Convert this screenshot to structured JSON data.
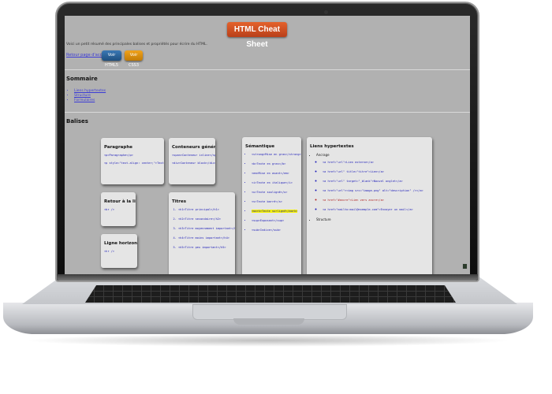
{
  "page": {
    "title": "HTML Cheat Sheet",
    "intro": "Voici un petit résumé des principales balises et propriétés pour écrire du HTML.",
    "top_link": "Retour page d'accueil",
    "button_blue": "Voir HTML5",
    "button_orange": "Voir CSS3"
  },
  "summary": {
    "heading": "Sommaire",
    "items": [
      "Liens hypertextes",
      "Structure",
      "Formulaires"
    ]
  },
  "tags": {
    "heading": "Balises",
    "paragraphe": {
      "title": "Paragraphe",
      "line1": "<p>Paragraphe</p>",
      "line2": "<p style=\"text-align: center;\">Texte</p>"
    },
    "conteneurs": {
      "title": "Conteneurs génériques",
      "line1": "<span>Conteneur inline</span>",
      "line2": "<div>Conteneur block</div>"
    },
    "retour": {
      "title": "Retour à la ligne",
      "code": "<br />"
    },
    "ligne": {
      "title": "Ligne horizontale",
      "code": "<hr />"
    },
    "titres": {
      "title": "Titres",
      "items": [
        "<h1>Titre principal</h1>",
        "<h2>Titre secondaire</h2>",
        "<h3>Titre moyennement important</h3>",
        "<h4>Titre moins important</h4>",
        "<h5>Titre peu important</h5>"
      ]
    },
    "semantique": {
      "title": "Sémantique",
      "items": [
        "<strong>Mise en gras</strong>",
        "<b>Texte en gras</b>",
        "<em>Mise en avant</em>",
        "<i>Texte en italique</i>",
        "<u>Texte souligné</u>",
        "<s>Texte barré</s>",
        "<mark>Texte surligné</mark>",
        "<sup>Exposant</sup>",
        "<sub>Indice</sub>"
      ]
    },
    "liens": {
      "title": "Liens hypertextes",
      "group_label": "Ancrage",
      "items": [
        "<a href=\"url\">Lien externe</a>",
        "<a href=\"url\" title=\"titre\">Lien</a>",
        "<a href=\"url\" target=\"_blank\">Nouvel onglet</a>",
        "<a href=\"url\"><img src=\"image.png\" alt=\"description\" /></a>",
        "<a href=\"#ancre\">Lien vers ancre</a>",
        "<a href=\"mailto:mail@exemple.com\">Envoyer un mail</a>"
      ],
      "last": "Structure"
    }
  }
}
